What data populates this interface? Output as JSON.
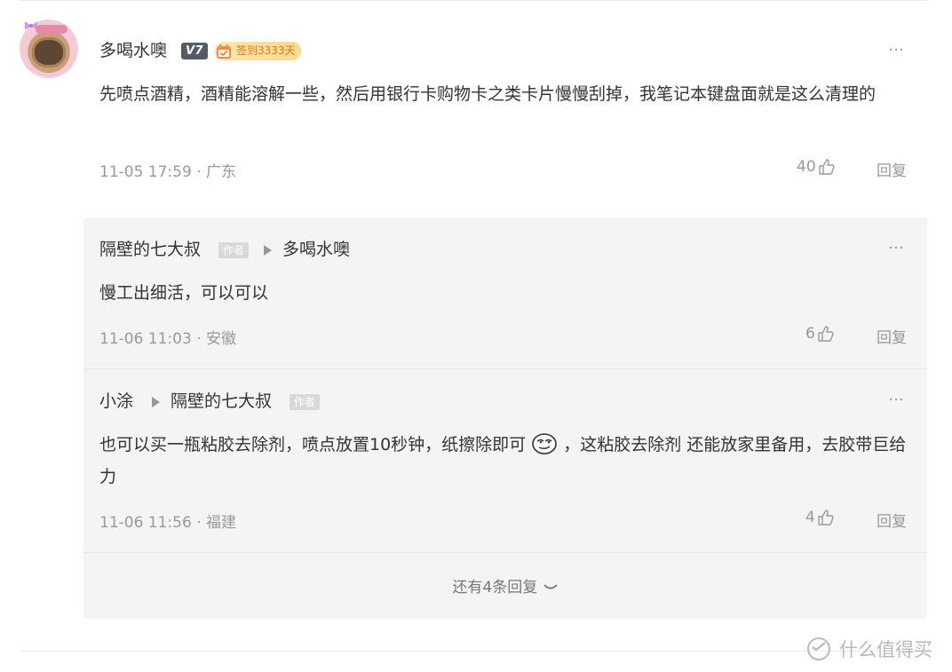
{
  "main_comment": {
    "author": "多喝水噢",
    "level": "V7",
    "checkin": "签到3333天",
    "content": "先喷点酒精，酒精能溶解一些，然后用银行卡购物卡之类卡片慢慢刮掉，我笔记本键盘面就是这么清理的",
    "time_location": "11-05 17:59 · 广东",
    "likes": "40",
    "reply_label": "回复",
    "more_label": "···"
  },
  "replies": [
    {
      "author": "隔壁的七大叔",
      "author_tag": "作者",
      "to": "多喝水噢",
      "content": "慢工出细活，可以可以",
      "time_location": "11-06 11:03 · 安徽",
      "likes": "6",
      "reply_label": "回复",
      "more_label": "···"
    },
    {
      "author": "小涂",
      "to": "隔壁的七大叔",
      "to_tag": "作者",
      "content_before_emoji": "也可以买一瓶粘胶去除剂，喷点放置10秒钟，纸擦除即可",
      "content_after_emoji": "，这粘胶去除剂 还能放家里备用，去胶带巨给力",
      "time_location": "11-06 11:56 · 福建",
      "likes": "4",
      "reply_label": "回复",
      "more_label": "···"
    }
  ],
  "more_replies": "还有4条回复",
  "watermark": "什么值得买",
  "colors": {
    "text": "#333333",
    "meta": "#999999",
    "reply_bg": "#f4f4f4",
    "checkin_text": "#d9791a",
    "level_bg": "#555b66"
  }
}
